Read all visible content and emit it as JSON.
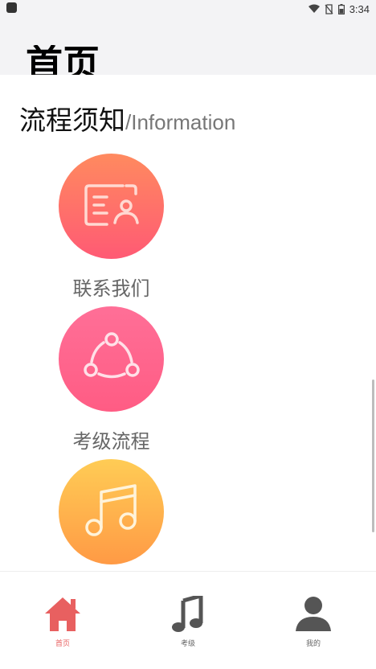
{
  "status_bar": {
    "time": "3:34",
    "icons": [
      "app-icon",
      "wifi-icon",
      "no-sim-icon",
      "battery-icon"
    ]
  },
  "header": {
    "title": "首页"
  },
  "section": {
    "title_cn": "流程须知",
    "title_en": "/Information"
  },
  "cards": [
    {
      "icon": "id-card-icon",
      "label": "联系我们",
      "gradient": [
        "#ff8a5f",
        "#ff5a74"
      ]
    },
    {
      "icon": "share-nodes-icon",
      "label": "考级流程",
      "gradient": [
        "#ff6f97",
        "#ff5c84"
      ]
    },
    {
      "icon": "music-note-icon",
      "label": "",
      "gradient": [
        "#ffcc55",
        "#ff9a45"
      ]
    }
  ],
  "tabs": [
    {
      "label": "首页",
      "icon": "home-icon",
      "active": true,
      "color": "#e86060"
    },
    {
      "label": "考级",
      "icon": "music-note-icon",
      "active": false,
      "color": "#555555"
    },
    {
      "label": "我的",
      "icon": "person-icon",
      "active": false,
      "color": "#555555"
    }
  ]
}
